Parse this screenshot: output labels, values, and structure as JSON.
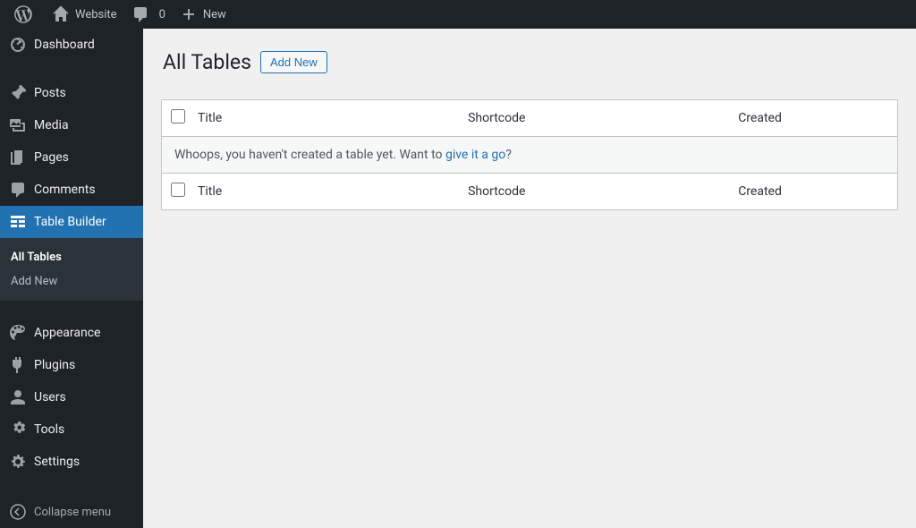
{
  "topbar": {
    "site_name": "Website",
    "comments_count": "0",
    "new_label": "New"
  },
  "sidebar": {
    "items": [
      {
        "label": "Dashboard",
        "icon": "dashboard"
      },
      {
        "label": "Posts",
        "icon": "pin"
      },
      {
        "label": "Media",
        "icon": "media"
      },
      {
        "label": "Pages",
        "icon": "pages"
      },
      {
        "label": "Comments",
        "icon": "comments"
      },
      {
        "label": "Table Builder",
        "icon": "table",
        "current": true
      },
      {
        "label": "Appearance",
        "icon": "appearance"
      },
      {
        "label": "Plugins",
        "icon": "plugins"
      },
      {
        "label": "Users",
        "icon": "users"
      },
      {
        "label": "Tools",
        "icon": "tools"
      },
      {
        "label": "Settings",
        "icon": "settings"
      }
    ],
    "submenu": [
      {
        "label": "All Tables",
        "current": true
      },
      {
        "label": "Add New"
      }
    ],
    "collapse_label": "Collapse menu"
  },
  "page": {
    "heading": "All Tables",
    "add_new_btn": "Add New"
  },
  "table": {
    "col_title": "Title",
    "col_shortcode": "Shortcode",
    "col_created": "Created",
    "empty_prefix": "Whoops, you haven't created a table yet. Want to ",
    "empty_link": "give it a go",
    "empty_suffix": "?"
  }
}
